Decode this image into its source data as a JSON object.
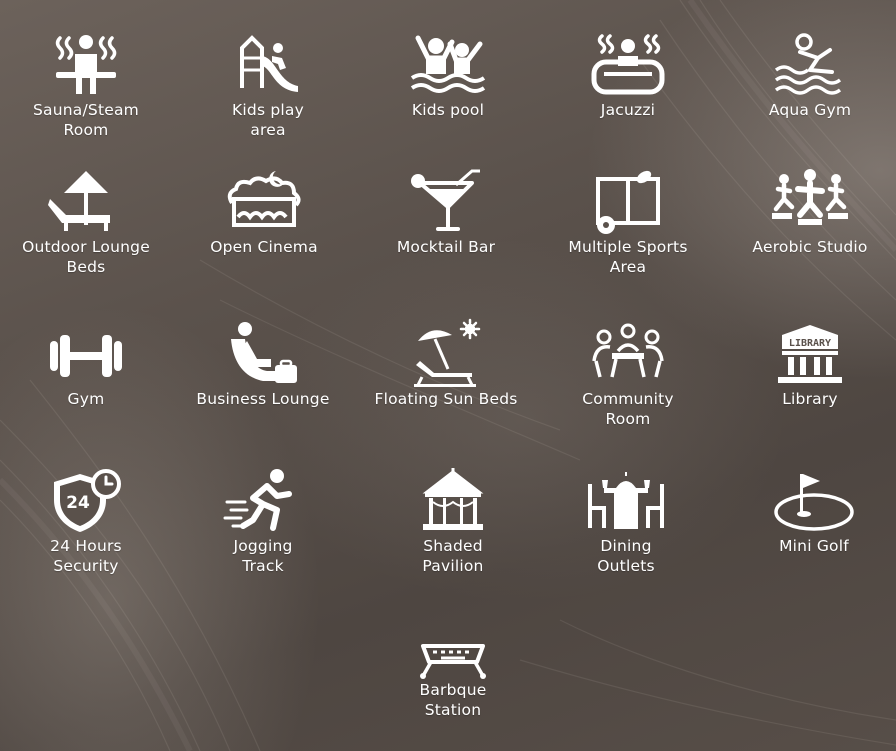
{
  "amenities": [
    {
      "label": "Sauna/Steam\nRoom",
      "icon": "sauna-icon"
    },
    {
      "label": "Kids play\narea",
      "icon": "playground-slide-icon"
    },
    {
      "label": "Kids pool",
      "icon": "kids-pool-icon"
    },
    {
      "label": "Jacuzzi",
      "icon": "jacuzzi-icon"
    },
    {
      "label": "Aqua Gym",
      "icon": "swimmer-icon"
    },
    {
      "label": "Outdoor Lounge\nBeds",
      "icon": "lounge-bed-umbrella-icon"
    },
    {
      "label": "Open Cinema",
      "icon": "cinema-screen-icon"
    },
    {
      "label": "Mocktail Bar",
      "icon": "cocktail-glass-icon"
    },
    {
      "label": "Multiple Sports\nArea",
      "icon": "sports-field-icon"
    },
    {
      "label": "Aerobic Studio",
      "icon": "step-aerobics-icon"
    },
    {
      "label": "Gym",
      "icon": "dumbbell-icon"
    },
    {
      "label": "Business Lounge",
      "icon": "business-lounge-icon"
    },
    {
      "label": "Floating Sun Beds",
      "icon": "sun-bed-icon"
    },
    {
      "label": "Community\nRoom",
      "icon": "community-meeting-icon"
    },
    {
      "label": "Library",
      "icon": "library-building-icon",
      "sign": "LIBRARY"
    },
    {
      "label": "24 Hours\nSecurity",
      "icon": "security-shield-clock-icon",
      "badge": "24"
    },
    {
      "label": "Jogging\nTrack",
      "icon": "running-man-icon"
    },
    {
      "label": "Shaded\nPavilion",
      "icon": "pavilion-gazebo-icon"
    },
    {
      "label": "Dining\nOutlets",
      "icon": "dining-table-icon"
    },
    {
      "label": "Mini Golf",
      "icon": "golf-flag-icon"
    },
    {
      "label": "Barbque\nStation",
      "icon": "barbecue-grill-icon"
    }
  ]
}
